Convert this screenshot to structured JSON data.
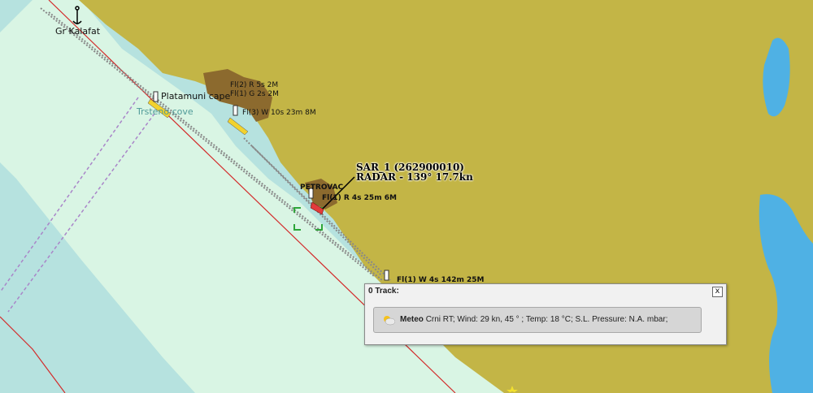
{
  "map": {
    "labels": [
      {
        "id": "place-kalafat",
        "text": "Gr Kalafat"
      },
      {
        "id": "place-platamuni",
        "text": "Platamuni cape"
      },
      {
        "id": "place-cove",
        "text": "Trsteno cove"
      },
      {
        "id": "place-petrovac",
        "text": "PETROVAC"
      }
    ],
    "lights": [
      "Fl(2) R 5s 2M",
      "Fl(1) G 2s 2M",
      "Fl(3) W 10s 23m 8M",
      "Fl(1) R 4s 25m 6M",
      "Fl(1) W 4s 142m 25M"
    ]
  },
  "vessel": {
    "name_line": "SAR_1 (262900010)",
    "radar_line": "RADAR - 139° 17.7kn"
  },
  "track_panel": {
    "title": "0 Track:",
    "close_label": "x",
    "meteo": {
      "label": "Meteo",
      "text": "Crni RT; Wind: 29 kn, 45 ° ; Temp: 18 °C; S.L. Pressure: N.A. mbar;"
    }
  },
  "colors": {
    "sea_deep": "#b6e2df",
    "sea_shallow": "#d9f5e4",
    "land": "#c3b546",
    "lake": "#4fb1e4",
    "town": "#8c6a2e"
  }
}
